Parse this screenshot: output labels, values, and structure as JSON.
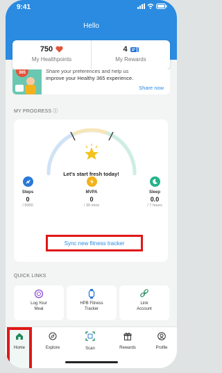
{
  "status_bar": {
    "time": "9:41"
  },
  "header": {
    "title": "Hello"
  },
  "stats": {
    "healthpoints": {
      "value": "750",
      "label": "My Healthpoints"
    },
    "rewards": {
      "value": "4",
      "label": "My Rewards"
    }
  },
  "banner": {
    "text_partial": "Share your preferences and help us",
    "text": "improve your Healthy 365 experience.",
    "link": "Share now",
    "badge": "365"
  },
  "progress": {
    "section_title": "MY PROGRESS ⓘ",
    "message": "Let's start fresh today!",
    "metrics": [
      {
        "name": "Steps",
        "value": "0",
        "target": "/ 5000",
        "color": "#2a78d8"
      },
      {
        "name": "MVPA",
        "value": "0",
        "target": "/ 30 mins",
        "color": "#f2b21b"
      },
      {
        "name": "Sleep",
        "value": "0.0",
        "target": "/ 7 hours",
        "color": "#27b38a"
      }
    ],
    "sync_label": "Sync new fitness tracker"
  },
  "quick_links": {
    "section_title": "QUICK LINKS",
    "items": [
      {
        "label_line1": "Log Your",
        "label_line2": "Meal",
        "icon": "meal-icon"
      },
      {
        "label_line1": "HPB Fitness",
        "label_line2": "Tracker",
        "icon": "watch-icon"
      },
      {
        "label_line1": "Link",
        "label_line2": "Account",
        "icon": "link-icon"
      }
    ]
  },
  "tabs": [
    {
      "label": "Home",
      "icon": "home-icon"
    },
    {
      "label": "Explore",
      "icon": "compass-icon"
    },
    {
      "label": "Scan",
      "icon": "scan-icon"
    },
    {
      "label": "Rewards",
      "icon": "gift-icon"
    },
    {
      "label": "Profile",
      "icon": "profile-icon"
    }
  ],
  "colors": {
    "primary": "#2a8be0",
    "highlight": "#e01818",
    "accent_green": "#1f8a5a"
  }
}
